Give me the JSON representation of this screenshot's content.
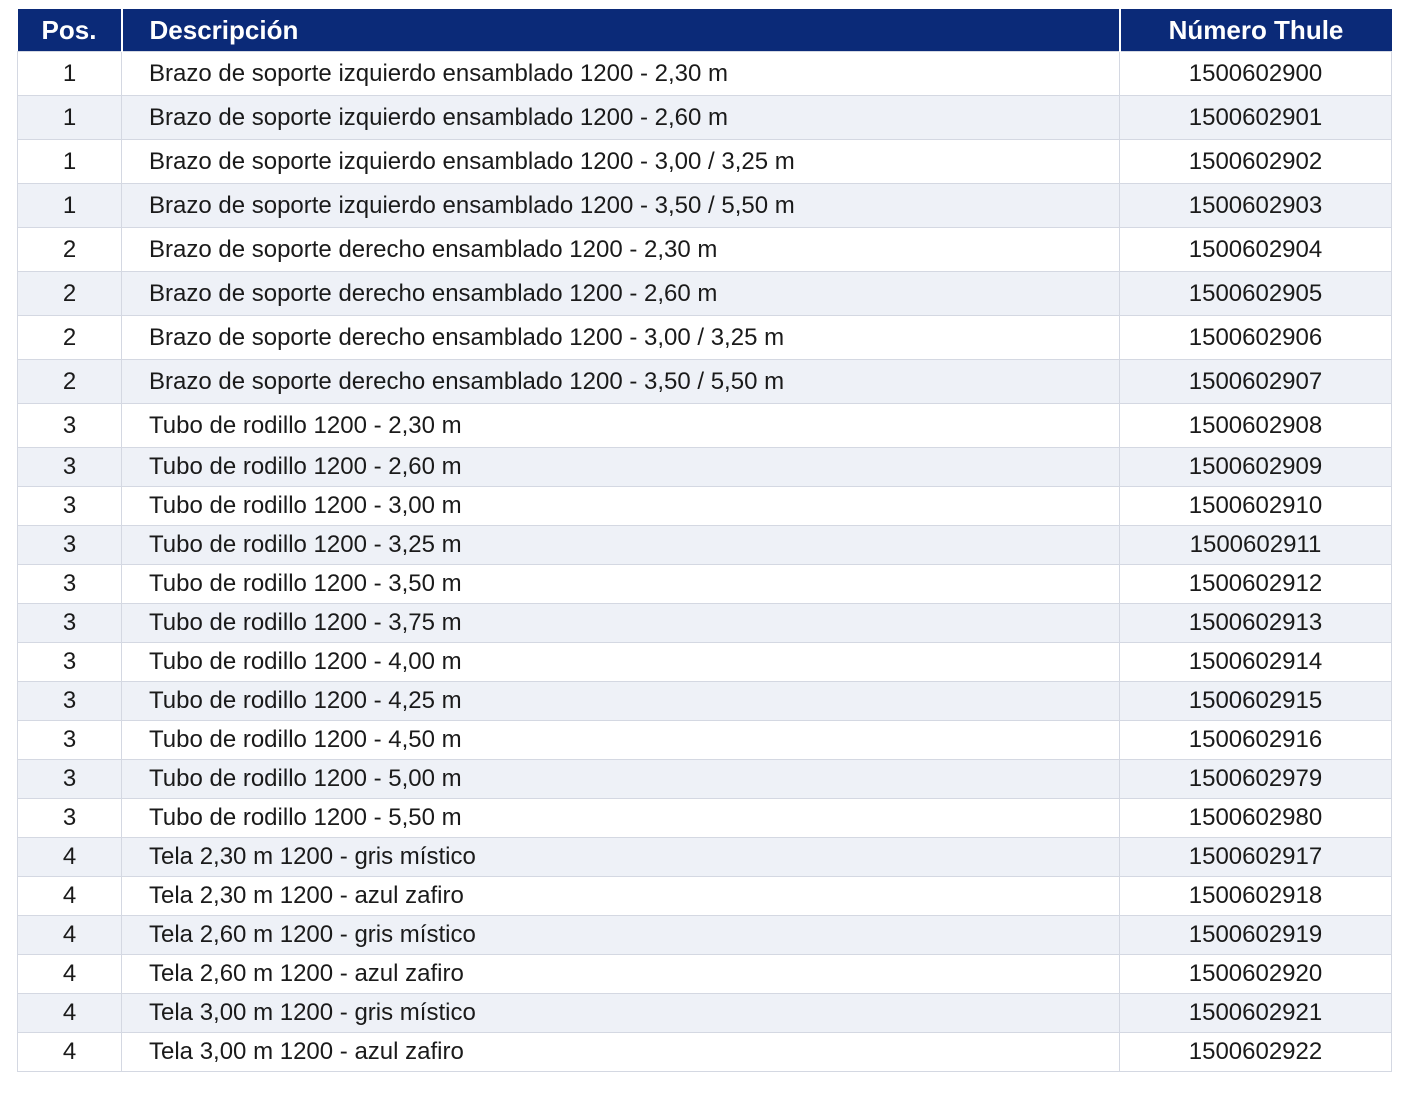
{
  "table": {
    "headers": {
      "pos": "Pos.",
      "desc": "Descripción",
      "num": "Número Thule"
    },
    "colors": {
      "header_bg": "#0b2a78",
      "header_text": "#ffffff",
      "stripe": "#eef1f7",
      "border": "#d4d8e2"
    },
    "rows": [
      {
        "pos": "1",
        "desc": "Brazo de soporte izquierdo ensamblado 1200 - 2,30 m",
        "num": "1500602900"
      },
      {
        "pos": "1",
        "desc": "Brazo de soporte izquierdo ensamblado 1200 - 2,60 m",
        "num": "1500602901"
      },
      {
        "pos": "1",
        "desc": "Brazo de soporte izquierdo ensamblado 1200 - 3,00 / 3,25 m",
        "num": "1500602902"
      },
      {
        "pos": "1",
        "desc": "Brazo de soporte izquierdo ensamblado 1200 - 3,50 / 5,50 m",
        "num": "1500602903"
      },
      {
        "pos": "2",
        "desc": "Brazo de soporte derecho ensamblado 1200 - 2,30 m",
        "num": "1500602904"
      },
      {
        "pos": "2",
        "desc": "Brazo de soporte derecho ensamblado 1200 - 2,60 m",
        "num": "1500602905"
      },
      {
        "pos": "2",
        "desc": "Brazo de soporte derecho ensamblado 1200 - 3,00 / 3,25 m",
        "num": "1500602906"
      },
      {
        "pos": "2",
        "desc": "Brazo de soporte derecho ensamblado 1200 - 3,50 / 5,50 m",
        "num": "1500602907"
      },
      {
        "pos": "3",
        "desc": "Tubo de rodillo 1200 - 2,30 m",
        "num": "1500602908"
      },
      {
        "pos": "3",
        "desc": "Tubo de rodillo 1200 - 2,60 m",
        "num": "1500602909"
      },
      {
        "pos": "3",
        "desc": "Tubo de rodillo 1200 - 3,00 m",
        "num": "1500602910"
      },
      {
        "pos": "3",
        "desc": "Tubo de rodillo 1200 - 3,25 m",
        "num": "1500602911"
      },
      {
        "pos": "3",
        "desc": "Tubo de rodillo 1200 - 3,50 m",
        "num": "1500602912"
      },
      {
        "pos": "3",
        "desc": "Tubo de rodillo 1200 - 3,75 m",
        "num": "1500602913"
      },
      {
        "pos": "3",
        "desc": "Tubo de rodillo 1200 - 4,00 m",
        "num": "1500602914"
      },
      {
        "pos": "3",
        "desc": "Tubo de rodillo 1200 - 4,25 m",
        "num": "1500602915"
      },
      {
        "pos": "3",
        "desc": "Tubo de rodillo 1200 - 4,50 m",
        "num": "1500602916"
      },
      {
        "pos": "3",
        "desc": "Tubo de rodillo 1200 - 5,00 m",
        "num": "1500602979"
      },
      {
        "pos": "3",
        "desc": "Tubo de rodillo 1200 - 5,50 m",
        "num": "1500602980"
      },
      {
        "pos": "4",
        "desc": "Tela 2,30 m 1200 - gris místico",
        "num": "1500602917"
      },
      {
        "pos": "4",
        "desc": "Tela 2,30 m 1200 - azul zafiro",
        "num": "1500602918"
      },
      {
        "pos": "4",
        "desc": "Tela 2,60 m 1200 - gris místico",
        "num": "1500602919"
      },
      {
        "pos": "4",
        "desc": "Tela 2,60 m 1200 - azul zafiro",
        "num": "1500602920"
      },
      {
        "pos": "4",
        "desc": "Tela 3,00 m 1200 - gris místico",
        "num": "1500602921"
      },
      {
        "pos": "4",
        "desc": "Tela 3,00 m 1200 - azul zafiro",
        "num": "1500602922"
      }
    ]
  }
}
